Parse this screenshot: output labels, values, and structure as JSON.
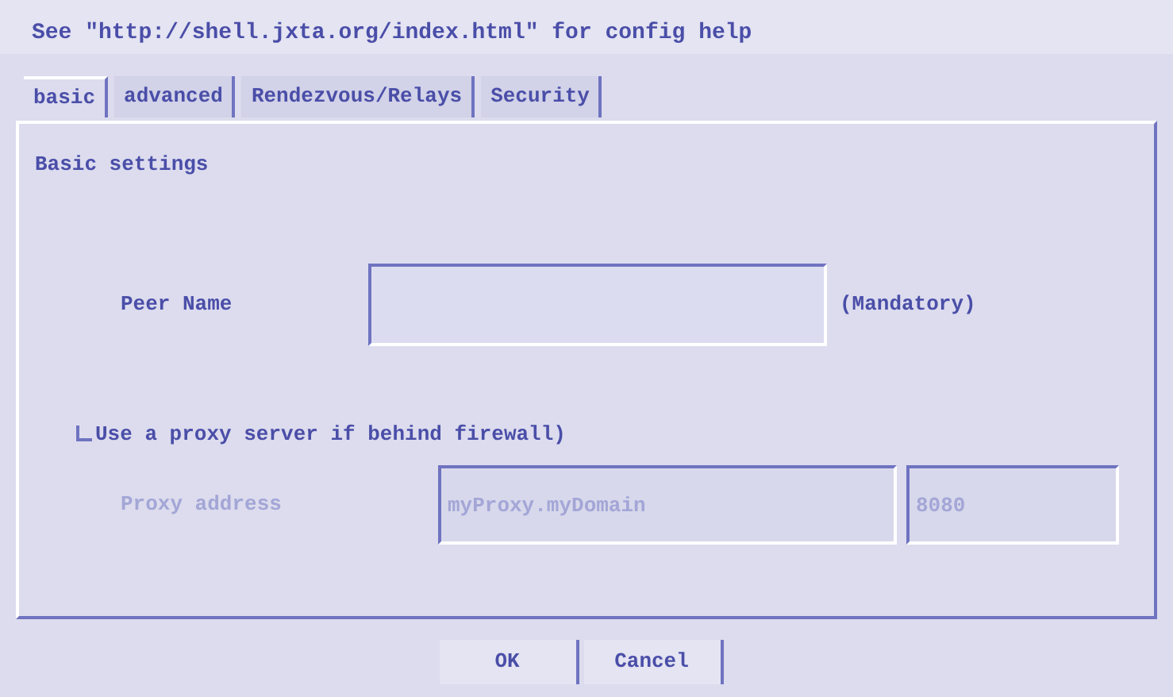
{
  "header": "See \"http://shell.jxta.org/index.html\" for config help",
  "tabs": [
    {
      "label": "basic",
      "selected": true
    },
    {
      "label": "advanced",
      "selected": false
    },
    {
      "label": "Rendezvous/Relays",
      "selected": false
    },
    {
      "label": "Security",
      "selected": false
    }
  ],
  "panel": {
    "title": "Basic settings",
    "peer_name": {
      "label": "Peer Name",
      "note": "(Mandatory)"
    },
    "proxy_checkbox": {
      "label": "Use a proxy server if behind firewall)",
      "checked": false
    },
    "proxy_address": {
      "label": "Proxy address",
      "disabled": true,
      "host": "myProxy.myDomain",
      "port": "8080"
    }
  },
  "buttons": [
    "OK",
    "Cancel"
  ]
}
